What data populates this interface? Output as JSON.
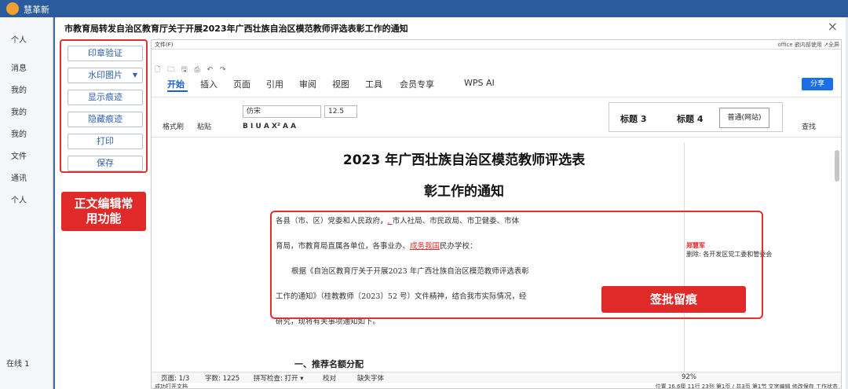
{
  "bg": {
    "app_name": "慧革新",
    "right_links": "WPS",
    "online": "在线 1"
  },
  "modal": {
    "title": "市教育局转发自治区教育厅关于开展2023年广西壮族自治区模范教师评选表彰工作的通知",
    "close": "×"
  },
  "left_buttons": [
    {
      "label": "印章验证"
    },
    {
      "label": "水印图片"
    },
    {
      "label": "显示痕迹"
    },
    {
      "label": "隐藏痕迹"
    },
    {
      "label": "打印"
    },
    {
      "label": "保存"
    }
  ],
  "annotations": {
    "left_tag": "正文编辑常用功能",
    "right_tag": "签批留痕"
  },
  "wps": {
    "menu": "文件(F)",
    "menu_right": "office 嵌内部使用 ↗全屏",
    "quick": "🗋 🗀 🖫 ⎙ ↶ ↷",
    "tabs": [
      "开始",
      "插入",
      "页面",
      "引用",
      "审阅",
      "视图",
      "工具",
      "会员专享",
      "WPS AI"
    ],
    "share": "分享",
    "ribbon": {
      "format_painter": "格式刷",
      "paste": "粘贴",
      "font": "仿宋",
      "size": "12.5",
      "biu": "B  I  U  A  X²  A  A",
      "styles": [
        "标题 3",
        "标题 4",
        "普通(网站)"
      ],
      "find": "查找"
    }
  },
  "doc": {
    "title_line1": "2023 年广西壮族自治区模范教师评选表",
    "title_line2": "彰工作的通知",
    "p1a": "各县（市、区）党委和人民政府，",
    "p1b": "市人社局、市民政局、市卫健委、市体",
    "p2a": "育局，市教育局直属各单位，各事业办、",
    "p2b": "成务我国",
    "p2c": "民办学校：",
    "p3": "根据《自治区教育厅关于开展2023 年广西壮族自治区模范教师评选表彰",
    "p4": "工作的通知》（桂教教师〔2023〕52 号）文件精神，结合我市实际情况，经",
    "p5": "研究，现将有关事项通知如下。",
    "h2": "一、推荐名额分配",
    "comment_author": "郑慧军",
    "comment_text": "删除: 各开发区党工委和管委会"
  },
  "status": {
    "page": "页面: 1/3",
    "words": "字数: 1225",
    "spell": "拼写检查: 打开 ▾",
    "proof": "校对",
    "font_missing": "缺失字体",
    "zoom": "92%"
  },
  "bottom": {
    "left": "成功打开文档",
    "right": "位置 16.6厘 11行 23列 第1页 / 共3页 第1节 文字编辑 修改保存 工作状态"
  }
}
